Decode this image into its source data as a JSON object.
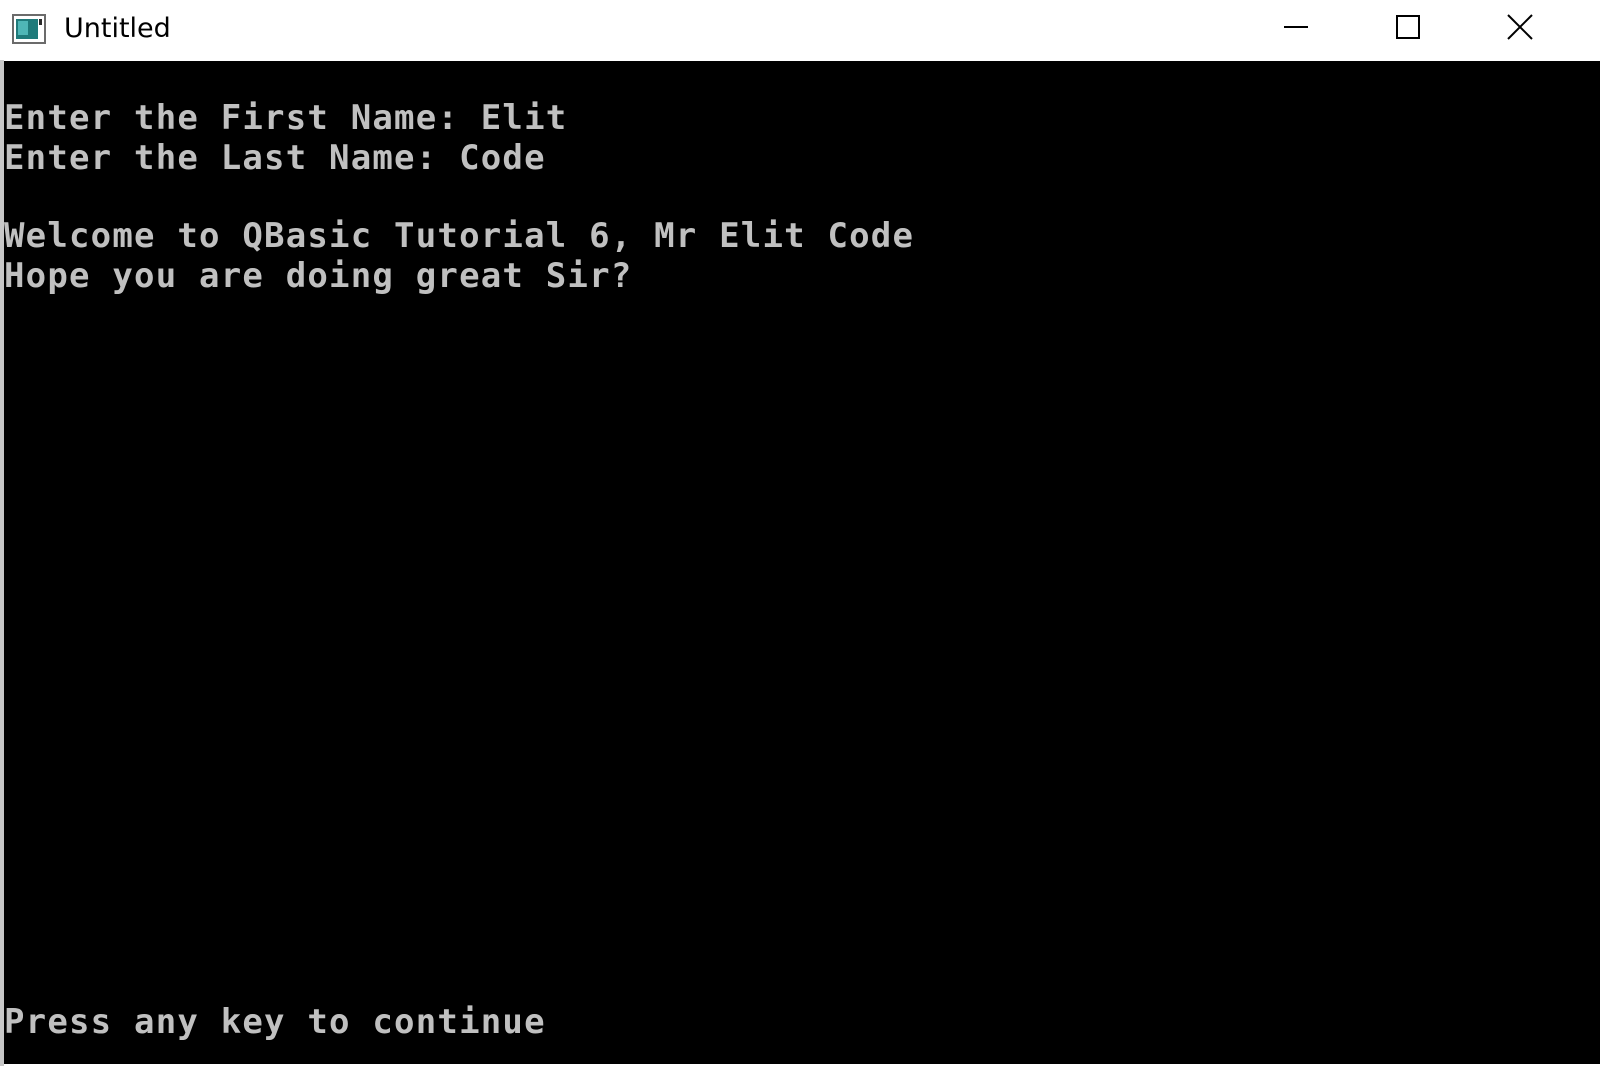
{
  "window": {
    "title": "Untitled"
  },
  "console": {
    "lines": [
      "Enter the First Name: Elit",
      "Enter the Last Name: Code",
      "Welcome to QBasic Tutorial 6, Mr Elit Code",
      "Hope you are doing great Sir?"
    ],
    "prompt": "Press any key to continue",
    "background": "#000000",
    "foreground": "#c0c0c0"
  },
  "icons": {
    "app": "console-app-icon",
    "minimize": "minimize-icon",
    "maximize": "maximize-icon",
    "close": "close-icon"
  }
}
